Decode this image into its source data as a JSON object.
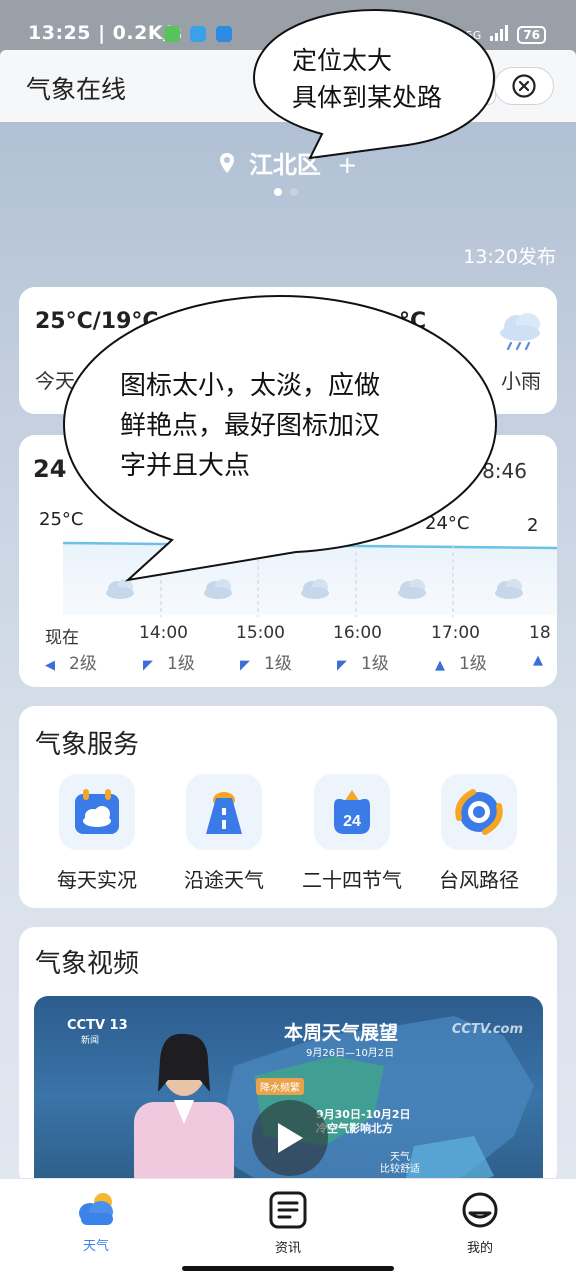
{
  "status_bar": {
    "time": "13:25",
    "speed": "0.2K/s",
    "network": "5G",
    "battery": "76"
  },
  "header": {
    "title": "气象在线"
  },
  "location": {
    "name": "江北区",
    "add": "+"
  },
  "publish_time": "13:20发布",
  "today_card": {
    "temp_range": "25°C/19°C",
    "day_label": "今天",
    "tomorrow_temp_partial": "°C",
    "condition": "小雨"
  },
  "hourly_card": {
    "current_temp_partial": "24",
    "sunset_partial": "8:46",
    "temp_labels": {
      "first": "25°C",
      "near_right": "24°C",
      "right_partial": "2"
    },
    "hours": [
      "现在",
      "14:00",
      "15:00",
      "16:00",
      "17:00",
      "18"
    ],
    "wind": [
      "2级",
      "1级",
      "1级",
      "1级",
      "1级"
    ]
  },
  "services": {
    "title": "气象服务",
    "items": [
      {
        "label": "每天实况",
        "icon": "calendar-cloud-icon"
      },
      {
        "label": "沿途天气",
        "icon": "road-icon"
      },
      {
        "label": "二十四节气",
        "icon": "solar-term-24-icon",
        "badge": "24"
      },
      {
        "label": "台风路径",
        "icon": "typhoon-icon"
      }
    ]
  },
  "video_section": {
    "title": "气象视频",
    "thumb": {
      "channel": "CCTV 13",
      "channel_sub": "新闻",
      "heading": "本周天气展望",
      "dates": "9月26日—10月2日",
      "tag_rain": "降水频繁",
      "tag_cold_dates": "9月30日-10月2日",
      "tag_cold": "冷空气影响北方",
      "tag_pleasant_1": "天气",
      "tag_pleasant_2": "比较舒适",
      "watermark": "CCTV.com"
    }
  },
  "bottom_nav": [
    {
      "label": "天气",
      "active": true
    },
    {
      "label": "资讯",
      "active": false
    },
    {
      "label": "我的",
      "active": false
    }
  ],
  "annotations": {
    "location_note": [
      "定位太大",
      "具体到某处路"
    ],
    "icon_note": [
      "图标太小，太淡，应做",
      "鲜艳点，最好图标加汉",
      "字并且大点"
    ]
  }
}
